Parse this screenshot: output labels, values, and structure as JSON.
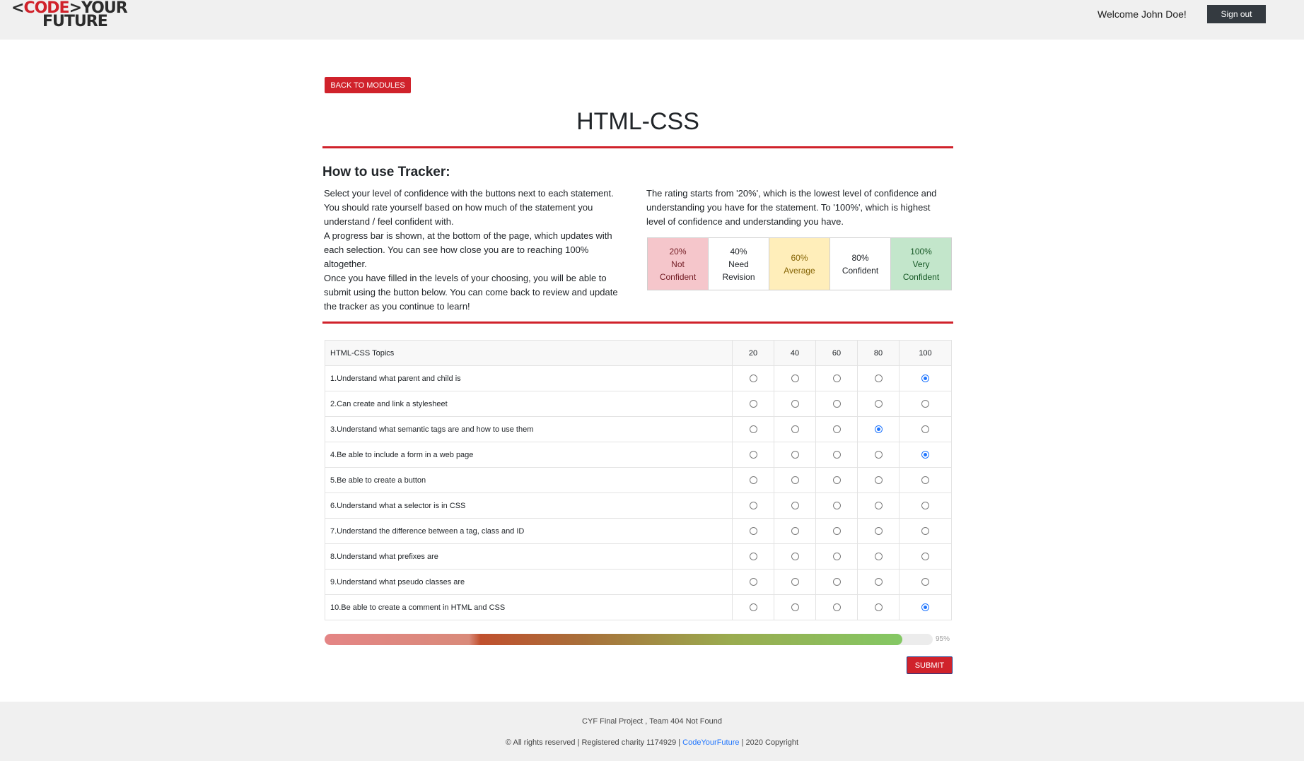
{
  "header": {
    "logo_code": "CODE",
    "logo_your": "YOUR",
    "logo_future": "FUTURE",
    "welcome": "Welcome John Doe!",
    "signout_label": "Sign out"
  },
  "main": {
    "back_label": "BACK TO MODULES",
    "title": "HTML-CSS",
    "how_title": "How to use Tracker:",
    "left_para": [
      "Select your level of confidence with the buttons next to each statement. You should rate yourself based on how much of the statement you understand / feel confident with.",
      "A progress bar is shown, at the bottom of the page, which updates with each selection. You can see how close you are to reaching 100% altogether.",
      "Once you have filled in the levels of your choosing, you will be able to submit using the button below. You can come back to review and update the tracker as you continue to learn!"
    ],
    "right_para": "The rating starts from '20%', which is the lowest level of confidence and understanding you have for the statement. To '100%', which is highest level of confidence and understanding you have.",
    "legend": [
      {
        "pct": "20%",
        "l1": "Not",
        "l2": "Confident",
        "bg": "#f5c6cb",
        "fg": "#721c24"
      },
      {
        "pct": "40%",
        "l1": "Need",
        "l2": "Revision",
        "bg": "#ffffff",
        "fg": "#212529"
      },
      {
        "pct": "60%",
        "l1": "Average",
        "l2": "",
        "bg": "#ffeeba",
        "fg": "#856404"
      },
      {
        "pct": "80%",
        "l1": "Confident",
        "l2": "",
        "bg": "#ffffff",
        "fg": "#212529"
      },
      {
        "pct": "100%",
        "l1": "Very",
        "l2": "Confident",
        "bg": "#c3e6cb",
        "fg": "#155724"
      }
    ]
  },
  "table": {
    "header": "HTML-CSS Topics",
    "levels": [
      "20",
      "40",
      "60",
      "80",
      "100"
    ],
    "rows": [
      {
        "topic": "1.Understand what parent and child is",
        "selected": 4
      },
      {
        "topic": "2.Can create and link a stylesheet",
        "selected": -1
      },
      {
        "topic": "3.Understand what semantic tags are and how to use them",
        "selected": 3
      },
      {
        "topic": "4.Be able to include a form in a web page",
        "selected": 4
      },
      {
        "topic": "5.Be able to create a button",
        "selected": -1
      },
      {
        "topic": "6.Understand what a selector is in CSS",
        "selected": -1
      },
      {
        "topic": "7.Understand the difference between a tag, class and ID",
        "selected": -1
      },
      {
        "topic": "8.Understand what prefixes are",
        "selected": -1
      },
      {
        "topic": "9.Understand what pseudo classes are",
        "selected": -1
      },
      {
        "topic": "10.Be able to create a comment in HTML and CSS",
        "selected": 4
      }
    ]
  },
  "progress": {
    "value": 0.95,
    "label": "95%"
  },
  "submit_label": "SUBMIT",
  "footer": {
    "line1": "CYF Final Project , Team 404 Not Found",
    "line2_prefix": "© All rights reserved | Registered charity 1174929 | ",
    "line2_link": "CodeYourFuture",
    "line2_suffix": " | 2020 Copyright"
  }
}
